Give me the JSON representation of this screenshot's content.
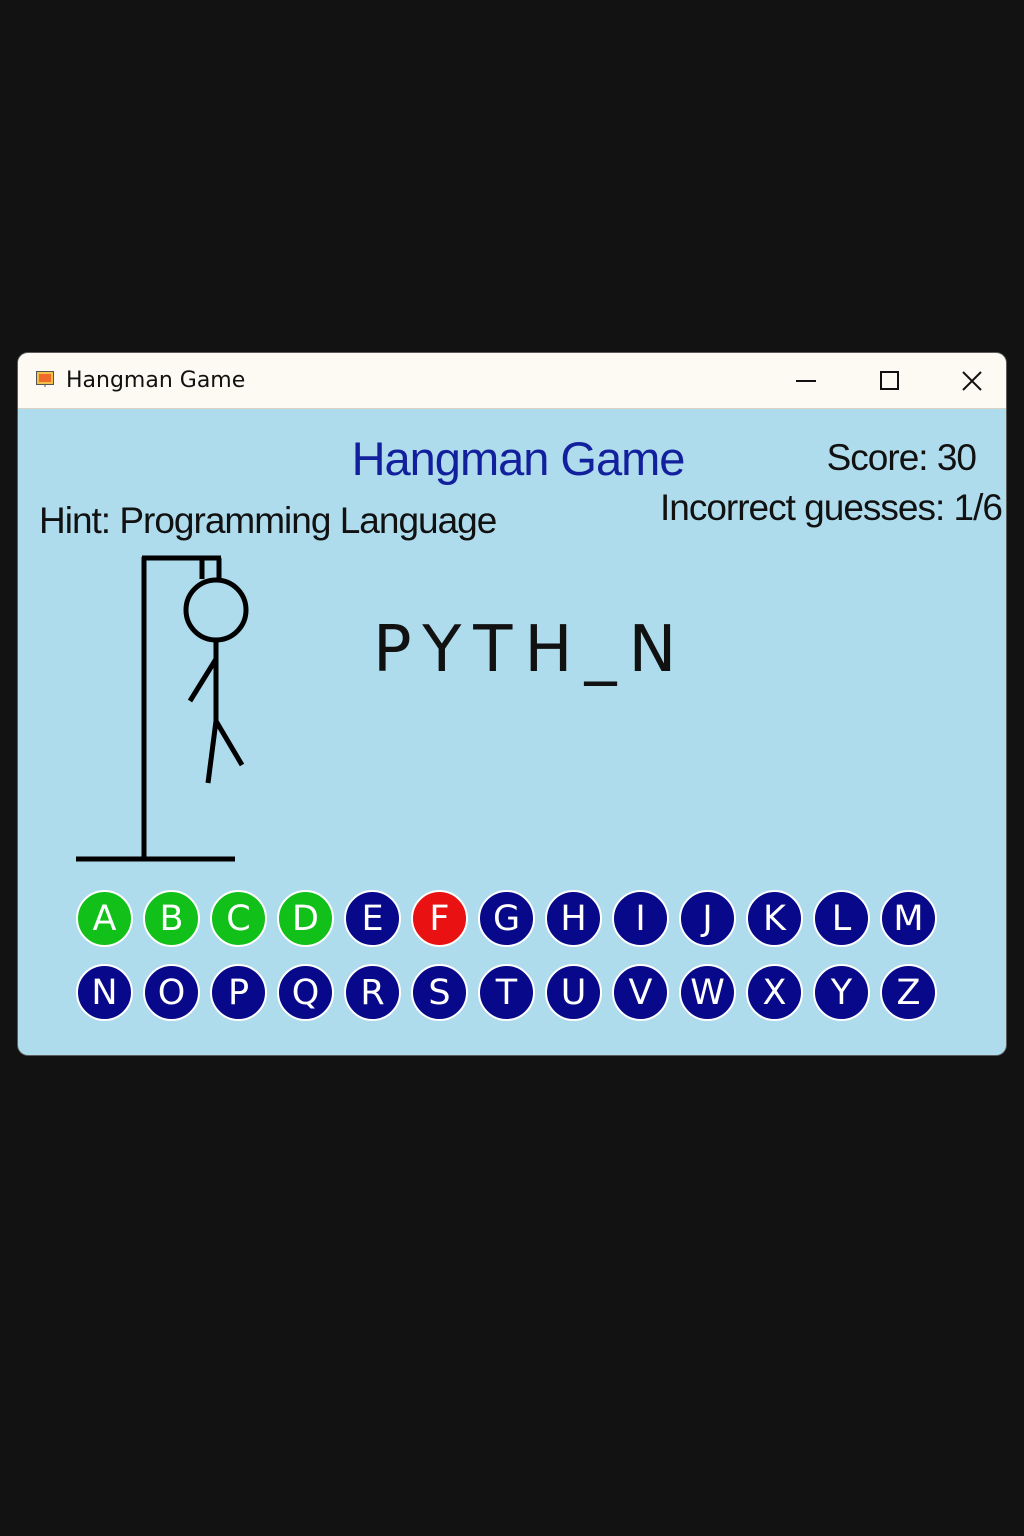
{
  "window": {
    "title": "Hangman Game"
  },
  "game": {
    "title": "Hangman Game",
    "score": "Score: 30",
    "incorrect": "Incorrect guesses: 1/6",
    "hint": "Hint: Programming Language",
    "word": "PYTH_N"
  },
  "colors": {
    "correct": "#11c11a",
    "wrong": "#e91111",
    "unused": "#08088a",
    "background": "#aedcec",
    "title": "#13209d"
  },
  "icons": {
    "app": "app-icon",
    "minimize": "minimize-icon",
    "maximize": "maximize-icon",
    "close": "close-icon"
  },
  "keys_row1": [
    {
      "letter": "A",
      "state": "correct"
    },
    {
      "letter": "B",
      "state": "correct"
    },
    {
      "letter": "C",
      "state": "correct"
    },
    {
      "letter": "D",
      "state": "correct"
    },
    {
      "letter": "E",
      "state": "unused"
    },
    {
      "letter": "F",
      "state": "wrong"
    },
    {
      "letter": "G",
      "state": "unused"
    },
    {
      "letter": "H",
      "state": "unused"
    },
    {
      "letter": "I",
      "state": "unused"
    },
    {
      "letter": "J",
      "state": "unused"
    },
    {
      "letter": "K",
      "state": "unused"
    },
    {
      "letter": "L",
      "state": "unused"
    },
    {
      "letter": "M",
      "state": "unused"
    }
  ],
  "keys_row2": [
    {
      "letter": "N",
      "state": "unused"
    },
    {
      "letter": "O",
      "state": "unused"
    },
    {
      "letter": "P",
      "state": "unused"
    },
    {
      "letter": "Q",
      "state": "unused"
    },
    {
      "letter": "R",
      "state": "unused"
    },
    {
      "letter": "S",
      "state": "unused"
    },
    {
      "letter": "T",
      "state": "unused"
    },
    {
      "letter": "U",
      "state": "unused"
    },
    {
      "letter": "V",
      "state": "unused"
    },
    {
      "letter": "W",
      "state": "unused"
    },
    {
      "letter": "X",
      "state": "unused"
    },
    {
      "letter": "Y",
      "state": "unused"
    },
    {
      "letter": "Z",
      "state": "unused"
    }
  ]
}
